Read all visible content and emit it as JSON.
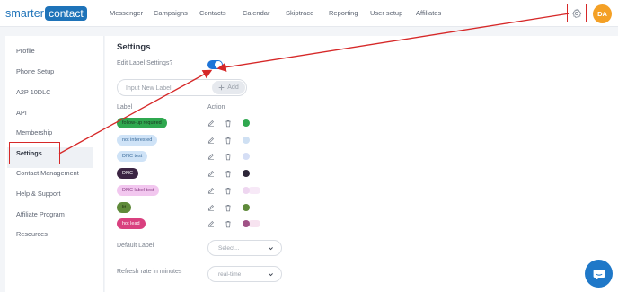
{
  "logo": {
    "part1": "smarter",
    "part2": "contact"
  },
  "nav": [
    "Messenger",
    "Campaigns",
    "Contacts",
    "Calendar",
    "Skiptrace",
    "Reporting",
    "User setup",
    "Affiliates"
  ],
  "user": {
    "initials": "DA"
  },
  "sidebar": {
    "items": [
      {
        "label": "Profile",
        "active": false
      },
      {
        "label": "Phone Setup",
        "active": false
      },
      {
        "label": "A2P 10DLC",
        "active": false
      },
      {
        "label": "API",
        "active": false
      },
      {
        "label": "Membership",
        "active": false
      },
      {
        "label": "Settings",
        "active": true
      },
      {
        "label": "Contact Management",
        "active": false
      },
      {
        "label": "Help & Support",
        "active": false
      },
      {
        "label": "Affiliate Program",
        "active": false
      },
      {
        "label": "Resources",
        "active": false
      }
    ]
  },
  "main": {
    "title": "Settings",
    "edit_label": "Edit Label Settings?",
    "edit_label_enabled": true,
    "input_placeholder": "Input New Label",
    "add_label": "Add",
    "col_label": "Label",
    "col_action": "Action",
    "labels": [
      {
        "text": "follow-up required",
        "bg": "#2fa84f",
        "fg": "#1b3320",
        "color": "#2fa84f"
      },
      {
        "text": "not interested",
        "bg": "#cfe3f7",
        "fg": "#3a6b9a",
        "color": "#cfe0f3"
      },
      {
        "text": "DNC test",
        "bg": "#cfe3f7",
        "fg": "#3a6b9a",
        "color": "#d5def5"
      },
      {
        "text": "DNC",
        "bg": "#3b2443",
        "fg": "#ffffff",
        "color": "#2d2638"
      },
      {
        "text": "DNC label test",
        "bg": "#f2c7ef",
        "fg": "#8a3f86",
        "color": "#eed6f0"
      },
      {
        "text": "lit",
        "bg": "#5f8a3a",
        "fg": "#1d2c10",
        "color": "#5f8a3a"
      },
      {
        "text": "hot lead",
        "bg": "#d9407f",
        "fg": "#ffffff",
        "color": "#a05286"
      }
    ],
    "default_label": {
      "label": "Default Label",
      "value": "Select..."
    },
    "refresh_rate": {
      "label": "Refresh rate in minutes",
      "value": "real-time"
    }
  },
  "icons": {
    "gear": "gear-icon",
    "edit": "pencil-icon",
    "delete": "trash-icon",
    "chat": "chat-icon",
    "add": "plus-icon",
    "select": "chevron-down-icon"
  },
  "colors": {
    "brand": "#1e73b9",
    "accent": "#1d74d8",
    "annotation": "#d62828",
    "avatar": "#f4a025"
  }
}
